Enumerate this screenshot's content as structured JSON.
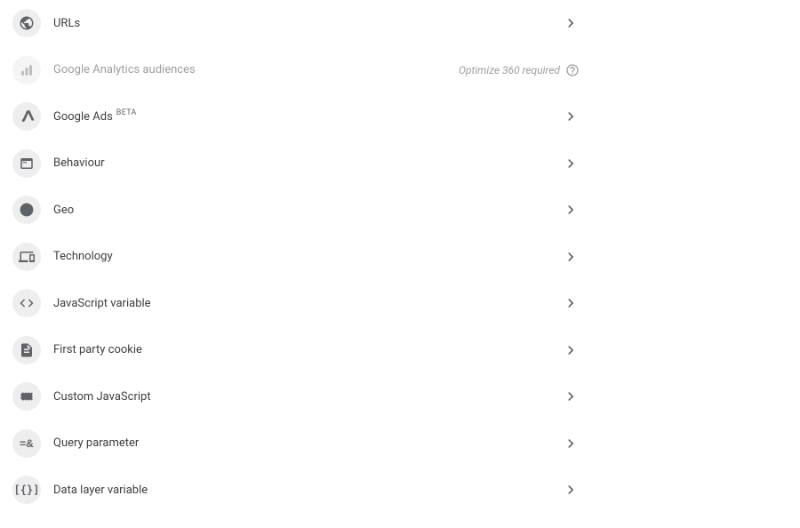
{
  "items": [
    {
      "id": "urls",
      "label": "URLs",
      "icon": "globe",
      "disabled": false
    },
    {
      "id": "ga-audiences",
      "label": "Google Analytics audiences",
      "icon": "analytics",
      "disabled": true,
      "meta": "Optimize 360 required"
    },
    {
      "id": "google-ads",
      "label": "Google Ads",
      "badge": "BETA",
      "icon": "ads",
      "disabled": false
    },
    {
      "id": "behaviour",
      "label": "Behaviour",
      "icon": "webpage",
      "disabled": false
    },
    {
      "id": "geo",
      "label": "Geo",
      "icon": "globe-lines",
      "disabled": false
    },
    {
      "id": "technology",
      "label": "Technology",
      "icon": "devices",
      "disabled": false
    },
    {
      "id": "js-variable",
      "label": "JavaScript variable",
      "icon": "code",
      "disabled": false
    },
    {
      "id": "cookie",
      "label": "First party cookie",
      "icon": "file",
      "disabled": false
    },
    {
      "id": "custom-js",
      "label": "Custom JavaScript",
      "icon": "ticket",
      "disabled": false
    },
    {
      "id": "query-param",
      "label": "Query parameter",
      "icon": "equals-amp",
      "disabled": false
    },
    {
      "id": "data-layer",
      "label": "Data layer variable",
      "icon": "brackets",
      "disabled": false
    }
  ]
}
